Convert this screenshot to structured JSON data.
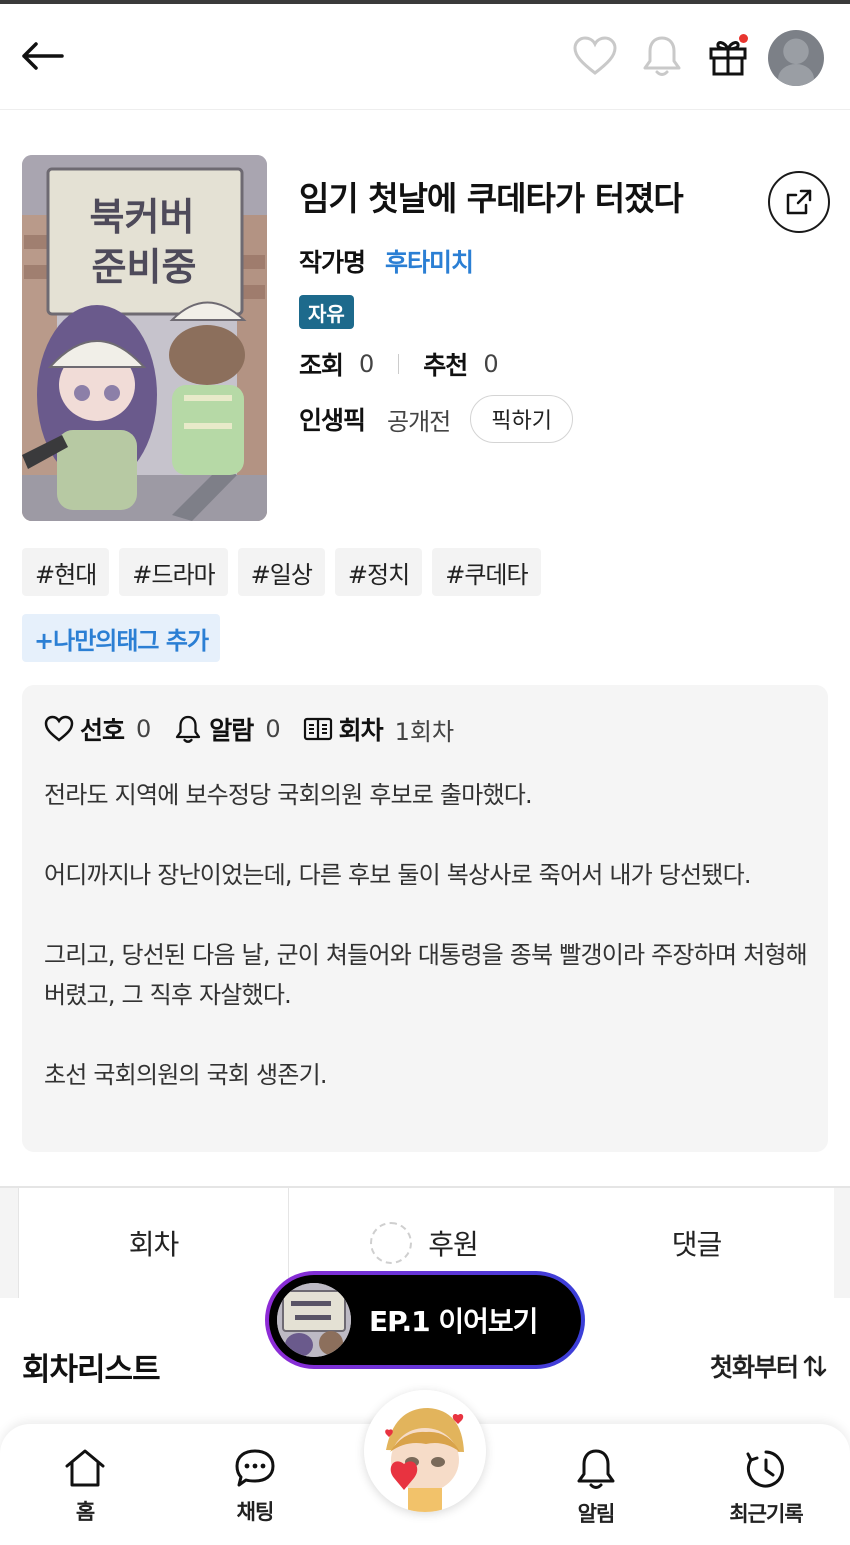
{
  "header": {
    "back_icon": "arrow-left-icon",
    "icons": [
      "heart-icon",
      "bell-icon",
      "gift-icon"
    ],
    "gift_notification_color": "#e8352f"
  },
  "cover": {
    "sign_text_line1": "북커버",
    "sign_text_line2": "준비중"
  },
  "novel": {
    "title": "임기 첫날에 쿠데타가 터졌다",
    "author_label": "작가명",
    "author": "후타미치",
    "badge": "자유",
    "views_label": "조회",
    "views": "0",
    "recommend_label": "추천",
    "recommend": "0",
    "pick_label": "인생픽",
    "pick_value": "공개전",
    "pick_button": "픽하기"
  },
  "tags": [
    "#현대",
    "#드라마",
    "#일상",
    "#정치",
    "#쿠데타"
  ],
  "add_tag_label": "+나만의태그 추가",
  "summary": {
    "like_label": "선호",
    "like_count": "0",
    "alarm_label": "알람",
    "alarm_count": "0",
    "episode_label": "회차",
    "episode_count": "1회차",
    "paragraphs": [
      "전라도 지역에 보수정당 국회의원 후보로 출마했다.",
      "어디까지나 장난이었는데, 다른 후보 둘이 복상사로 죽어서 내가 당선됐다.",
      "그리고, 당선된 다음 날, 군이 쳐들어와 대통령을 종북 빨갱이라 주장하며 처형해 버렸고, 그 직후 자살했다.",
      "초선 국회의원의 국회 생존기."
    ]
  },
  "tabs": {
    "episodes": "회차",
    "support": "후원",
    "comments": "댓글"
  },
  "continue_button": "EP.1 이어보기",
  "list": {
    "title": "회차리스트",
    "sort": "첫화부터"
  },
  "bottom_nav": {
    "home": "홈",
    "chat": "채팅",
    "alarm": "알림",
    "recent": "최근기록"
  },
  "colors": {
    "accent_blue": "#2b7fd4",
    "badge_bg": "#1d6a8c",
    "pill_gradient_start": "#8e2bd6",
    "pill_gradient_end": "#3a3fd8"
  }
}
